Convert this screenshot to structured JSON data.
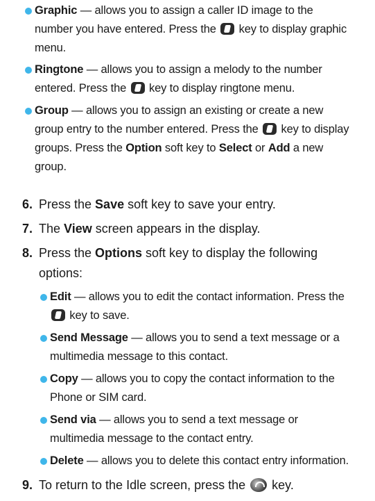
{
  "accent": "#3fb6ea",
  "sublist_top": [
    {
      "term": "Graphic",
      "desc_a": " — allows you to assign a caller ID image to the number you have entered. Press the ",
      "desc_b": " key to display graphic menu."
    },
    {
      "term": "Ringtone",
      "desc_a": " — allows you to assign a melody to the number entered. Press the ",
      "desc_b": " key to display ringtone menu."
    },
    {
      "term": "Group",
      "desc_a": " — allows you to assign an existing or create a new group entry to the number entered. Press the ",
      "desc_b": " key to display groups. Press the ",
      "opt": "Option",
      "desc_c": " soft key to ",
      "sel": "Select",
      "or": " or ",
      "add": "Add",
      "desc_d": " a new group."
    }
  ],
  "steps": {
    "s6": {
      "num": "6.",
      "a": "Press the ",
      "b": "Save",
      "c": " soft key to save your entry."
    },
    "s7": {
      "num": "7.",
      "a": "The ",
      "b": "View",
      "c": " screen appears in the display."
    },
    "s8": {
      "num": "8.",
      "a": "Press the ",
      "b": "Options",
      "c": " soft key to display the following options:"
    },
    "s9": {
      "num": "9.",
      "a": "To return to the Idle screen, press the ",
      "c": " key."
    }
  },
  "options": [
    {
      "term": "Edit",
      "desc_a": " — allows you to edit the contact information. Press the ",
      "desc_b": " key to save."
    },
    {
      "term": "Send Message",
      "desc": " — allows you to send a text message or a multimedia message to this contact."
    },
    {
      "term": "Copy",
      "desc": " — allows you to copy the contact information to the Phone or SIM card."
    },
    {
      "term": "Send via",
      "desc": " — allows you to send a text message or multimedia message to the contact entry."
    },
    {
      "term": "Delete",
      "desc": " — allows you to delete this contact entry information."
    }
  ],
  "icons": {
    "ok_key": "ok-key-icon",
    "end_key": "end-key-icon"
  }
}
